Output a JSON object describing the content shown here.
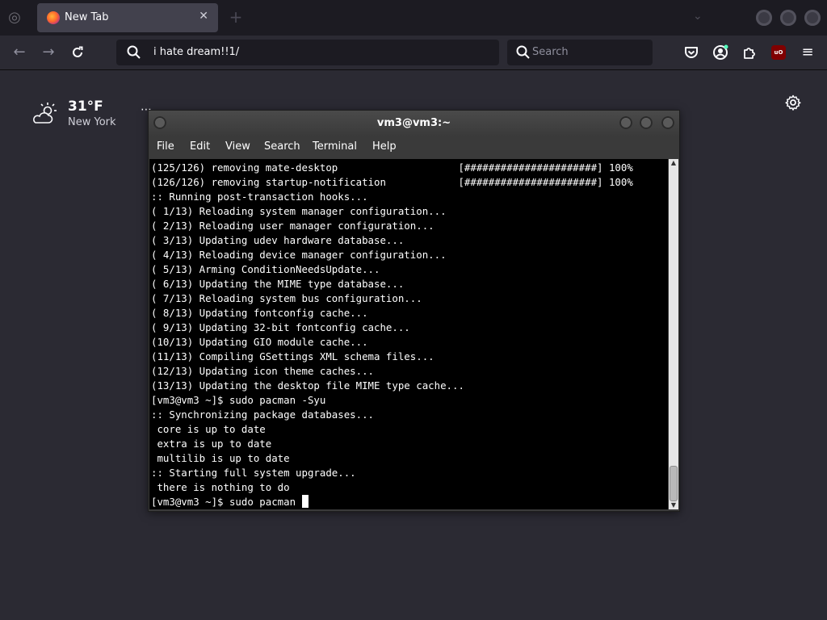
{
  "browser": {
    "tab": {
      "title": "New Tab",
      "favicon": "firefox-icon"
    },
    "address_bar": {
      "value": "i hate dream!!1/"
    },
    "search_bar": {
      "placeholder": "Search"
    },
    "toolbar_icons": [
      "back-icon",
      "forward-icon",
      "reload-icon",
      "pocket-icon",
      "account-icon",
      "extensions-icon",
      "ublock-icon",
      "menu-icon"
    ],
    "ublock_label": "uO"
  },
  "newtab": {
    "weather": {
      "temperature": "31°F",
      "city": "New York",
      "more": "⋯"
    }
  },
  "terminal": {
    "title": "vm3@vm3:~",
    "menus": [
      "File",
      "Edit",
      "View",
      "Search",
      "Terminal",
      "Help"
    ],
    "lines": [
      "(125/126) removing mate-desktop                    [######################] 100%",
      "(126/126) removing startup-notification            [######################] 100%",
      ":: Running post-transaction hooks...",
      "( 1/13) Reloading system manager configuration...",
      "( 2/13) Reloading user manager configuration...",
      "( 3/13) Updating udev hardware database...",
      "( 4/13) Reloading device manager configuration...",
      "( 5/13) Arming ConditionNeedsUpdate...",
      "( 6/13) Updating the MIME type database...",
      "( 7/13) Reloading system bus configuration...",
      "( 8/13) Updating fontconfig cache...",
      "( 9/13) Updating 32-bit fontconfig cache...",
      "(10/13) Updating GIO module cache...",
      "(11/13) Compiling GSettings XML schema files...",
      "(12/13) Updating icon theme caches...",
      "(13/13) Updating the desktop file MIME type cache...",
      "[vm3@vm3 ~]$ sudo pacman -Syu",
      ":: Synchronizing package databases...",
      " core is up to date",
      " extra is up to date",
      " multilib is up to date",
      ":: Starting full system upgrade...",
      " there is nothing to do"
    ],
    "prompt_line": "[vm3@vm3 ~]$ sudo pacman "
  },
  "colors": {
    "chrome_dark": "#1c1b22",
    "page_bg": "#2b2a33",
    "terminal_bg": "#000000",
    "terminal_fg": "#ffffff"
  }
}
